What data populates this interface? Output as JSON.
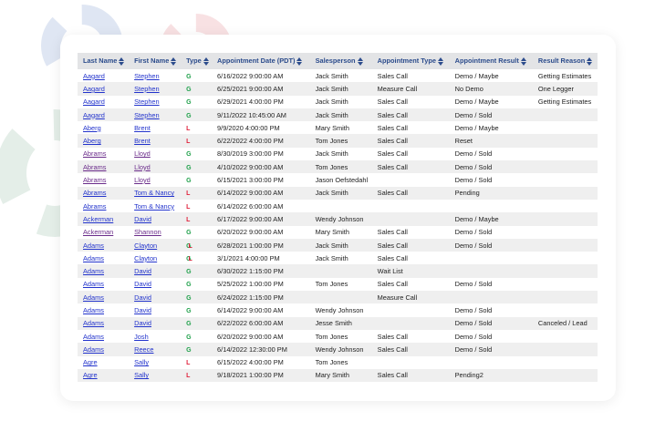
{
  "colors": {
    "header_text": "#2c4c8c",
    "link": "#2233cc",
    "visited_link": "#6a2b8a",
    "type_g": "#1fa04a",
    "type_l": "#e0203a"
  },
  "columns": [
    "Last Name",
    "First Name",
    "Type",
    "Appointment Date (PDT)",
    "Salesperson",
    "Appointment Type",
    "Appointment Result",
    "Result Reason"
  ],
  "rows": [
    {
      "last": "Aagard",
      "first": "Stephen",
      "type": "G",
      "date": "6/16/2022 9:00:00 AM",
      "sales": "Jack Smith",
      "atype": "Sales Call",
      "result": "Demo / Maybe",
      "reason": "Getting Estimates"
    },
    {
      "last": "Aagard",
      "first": "Stephen",
      "type": "G",
      "date": "6/25/2021 9:00:00 AM",
      "sales": "Jack Smith",
      "atype": "Measure Call",
      "result": "No Demo",
      "reason": "One Legger"
    },
    {
      "last": "Aagard",
      "first": "Stephen",
      "type": "G",
      "date": "6/29/2021 4:00:00 PM",
      "sales": "Jack Smith",
      "atype": "Sales Call",
      "result": "Demo / Maybe",
      "reason": "Getting Estimates"
    },
    {
      "last": "Aagard",
      "first": "Stephen",
      "type": "G",
      "date": "9/11/2022 10:45:00 AM",
      "sales": "Jack Smith",
      "atype": "Sales Call",
      "result": "Demo / Sold",
      "reason": ""
    },
    {
      "last": "Aberg",
      "first": "Brent",
      "type": "L",
      "date": "9/9/2020 4:00:00 PM",
      "sales": "Mary Smith",
      "atype": "Sales Call",
      "result": "Demo / Maybe",
      "reason": ""
    },
    {
      "last": "Aberg",
      "first": "Brent",
      "type": "L",
      "date": "6/22/2022 4:00:00 PM",
      "sales": "Tom Jones",
      "atype": "Sales Call",
      "result": "Reset",
      "reason": ""
    },
    {
      "last": "Abrams",
      "first": "Lloyd",
      "type": "G",
      "date": "8/30/2019 3:00:00 PM",
      "sales": "Jack Smith",
      "atype": "Sales Call",
      "result": "Demo / Sold",
      "reason": "",
      "visited": true
    },
    {
      "last": "Abrams",
      "first": "Lloyd",
      "type": "G",
      "date": "4/10/2022 9:00:00 AM",
      "sales": "Tom Jones",
      "atype": "Sales Call",
      "result": "Demo / Sold",
      "reason": "",
      "visited": true
    },
    {
      "last": "Abrams",
      "first": "Lloyd",
      "type": "G",
      "date": "6/15/2021 3:00:00 PM",
      "sales": "Jason Oefstedahl",
      "atype": "",
      "result": "Demo / Sold",
      "reason": "",
      "visited": true
    },
    {
      "last": "Abrams",
      "first": "Tom & Nancy",
      "type": "L",
      "date": "6/14/2022 9:00:00 AM",
      "sales": "Jack Smith",
      "atype": "Sales Call",
      "result": "Pending",
      "reason": ""
    },
    {
      "last": "Abrams",
      "first": "Tom & Nancy",
      "type": "L",
      "date": "6/14/2022 6:00:00 AM",
      "sales": "",
      "atype": "",
      "result": "",
      "reason": ""
    },
    {
      "last": "Ackerman",
      "first": "David",
      "type": "L",
      "date": "6/17/2022 9:00:00 AM",
      "sales": "Wendy Johnson",
      "atype": "",
      "result": "Demo / Maybe",
      "reason": ""
    },
    {
      "last": "Ackerman",
      "first": "Shannon",
      "type": "G",
      "date": "6/20/2022 9:00:00 AM",
      "sales": "Mary Smith",
      "atype": "Sales Call",
      "result": "Demo / Sold",
      "reason": "",
      "visited": true
    },
    {
      "last": "Adams",
      "first": "Clayton",
      "type": "GL",
      "date": "6/28/2021 1:00:00 PM",
      "sales": "Jack Smith",
      "atype": "Sales Call",
      "result": "Demo / Sold",
      "reason": ""
    },
    {
      "last": "Adams",
      "first": "Clayton",
      "type": "GL",
      "date": "3/1/2021 4:00:00 PM",
      "sales": "Jack Smith",
      "atype": "Sales Call",
      "result": "",
      "reason": ""
    },
    {
      "last": "Adams",
      "first": "David",
      "type": "G",
      "date": "6/30/2022 1:15:00 PM",
      "sales": "",
      "atype": "Wait List",
      "result": "",
      "reason": ""
    },
    {
      "last": "Adams",
      "first": "David",
      "type": "G",
      "date": "5/25/2022 1:00:00 PM",
      "sales": "Tom Jones",
      "atype": "Sales Call",
      "result": "Demo / Sold",
      "reason": ""
    },
    {
      "last": "Adams",
      "first": "David",
      "type": "G",
      "date": "6/24/2022 1:15:00 PM",
      "sales": "",
      "atype": "Measure Call",
      "result": "",
      "reason": ""
    },
    {
      "last": "Adams",
      "first": "David",
      "type": "G",
      "date": "6/14/2022 9:00:00 AM",
      "sales": "Wendy Johnson",
      "atype": "",
      "result": "Demo / Sold",
      "reason": ""
    },
    {
      "last": "Adams",
      "first": "David",
      "type": "G",
      "date": "6/22/2022 6:00:00 AM",
      "sales": "Jesse Smith",
      "atype": "",
      "result": "Demo / Sold",
      "reason": "Canceled / Lead"
    },
    {
      "last": "Adams",
      "first": "Josh",
      "type": "G",
      "date": "6/20/2022 9:00:00 AM",
      "sales": "Tom Jones",
      "atype": "Sales Call",
      "result": "Demo / Sold",
      "reason": ""
    },
    {
      "last": "Adams",
      "first": "Reece",
      "type": "G",
      "date": "6/14/2022 12:30:00 PM",
      "sales": "Wendy Johnson",
      "atype": "Sales Call",
      "result": "Demo / Sold",
      "reason": ""
    },
    {
      "last": "Agre",
      "first": "Sally",
      "type": "L",
      "date": "6/15/2022 4:00:00 PM",
      "sales": "Tom Jones",
      "atype": "",
      "result": "",
      "reason": ""
    },
    {
      "last": "Agre",
      "first": "Sally",
      "type": "L",
      "date": "9/18/2021 1:00:00 PM",
      "sales": "Mary Smith",
      "atype": "Sales Call",
      "result": "Pending2",
      "reason": ""
    }
  ]
}
